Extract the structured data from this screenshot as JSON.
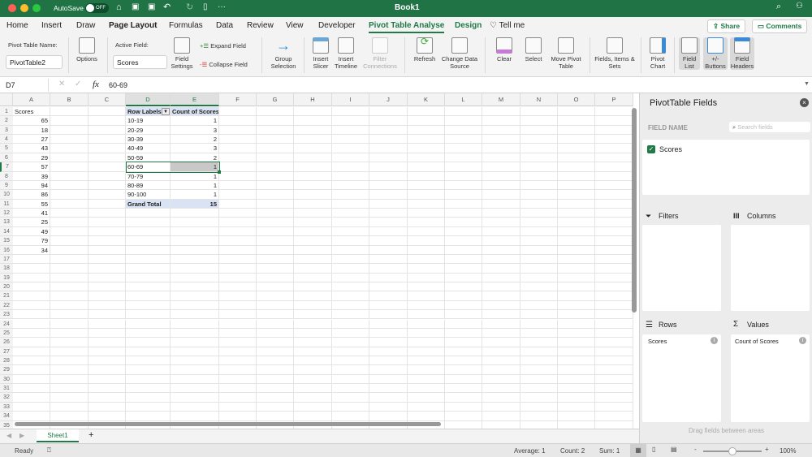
{
  "window": {
    "title": "Book1",
    "autosave_label": "AutoSave",
    "autosave_state": "OFF",
    "more": "···"
  },
  "menu_tabs": [
    "Home",
    "Insert",
    "Draw",
    "Page Layout",
    "Formulas",
    "Data",
    "Review",
    "View",
    "Developer",
    "Pivot Table Analyse",
    "Design"
  ],
  "active_tab": "Pivot Table Analyse",
  "tell_me": "Tell me",
  "share": "Share",
  "comments": "Comments",
  "ribbon": {
    "pivot_name_label": "Pivot Table Name:",
    "pivot_name_value": "PivotTable2",
    "options": "Options",
    "active_field_label": "Active Field:",
    "active_field_value": "Scores",
    "field_settings": "Field Settings",
    "expand_field": "Expand Field",
    "collapse_field": "Collapse Field",
    "group_selection": "Group Selection",
    "insert_slicer": "Insert Slicer",
    "insert_timeline": "Insert Timeline",
    "filter_connections": "Filter Connections",
    "refresh": "Refresh",
    "change_data_source": "Change Data Source",
    "clear": "Clear",
    "select": "Select",
    "move_pivot": "Move Pivot Table",
    "fields_items_sets": "Fields, Items & Sets",
    "pivot_chart": "Pivot Chart",
    "field_list": "Field List",
    "plus_minus": "+/- Buttons",
    "field_headers": "Field Headers"
  },
  "formula_bar": {
    "name_box": "D7",
    "fx": "fx",
    "value": "60-69"
  },
  "columns": [
    "A",
    "B",
    "C",
    "D",
    "E",
    "F",
    "G",
    "H",
    "I",
    "J",
    "K",
    "L",
    "M",
    "N",
    "O",
    "P"
  ],
  "column_a": {
    "header": "Scores",
    "values": [
      "65",
      "18",
      "27",
      "43",
      "29",
      "57",
      "39",
      "94",
      "86",
      "55",
      "41",
      "25",
      "49",
      "79",
      "34"
    ]
  },
  "pivot": {
    "row_labels": "Row Labels",
    "count_header": "Count of Scores",
    "rows": [
      [
        "10-19",
        "1"
      ],
      [
        "20-29",
        "3"
      ],
      [
        "30-39",
        "2"
      ],
      [
        "40-49",
        "3"
      ],
      [
        "50-59",
        "2"
      ],
      [
        "60-69",
        "1"
      ],
      [
        "70-79",
        "1"
      ],
      [
        "80-89",
        "1"
      ],
      [
        "90-100",
        "1"
      ]
    ],
    "grand_total_label": "Grand Total",
    "grand_total": "15"
  },
  "pane": {
    "title": "PivotTable Fields",
    "field_name": "FIELD NAME",
    "search_placeholder": "Search fields",
    "fields": [
      {
        "name": "Scores",
        "checked": true
      }
    ],
    "filters": "Filters",
    "columns": "Columns",
    "rows": "Rows",
    "values": "Values",
    "rows_items": [
      "Scores"
    ],
    "values_items": [
      "Count of Scores"
    ],
    "hint": "Drag fields between areas"
  },
  "sheet_tabs": [
    "Sheet1"
  ],
  "status": {
    "ready": "Ready",
    "average": "Average: 1",
    "count": "Count: 2",
    "sum": "Sum: 1",
    "zoom": "100%",
    "zoom_percent": 100
  }
}
